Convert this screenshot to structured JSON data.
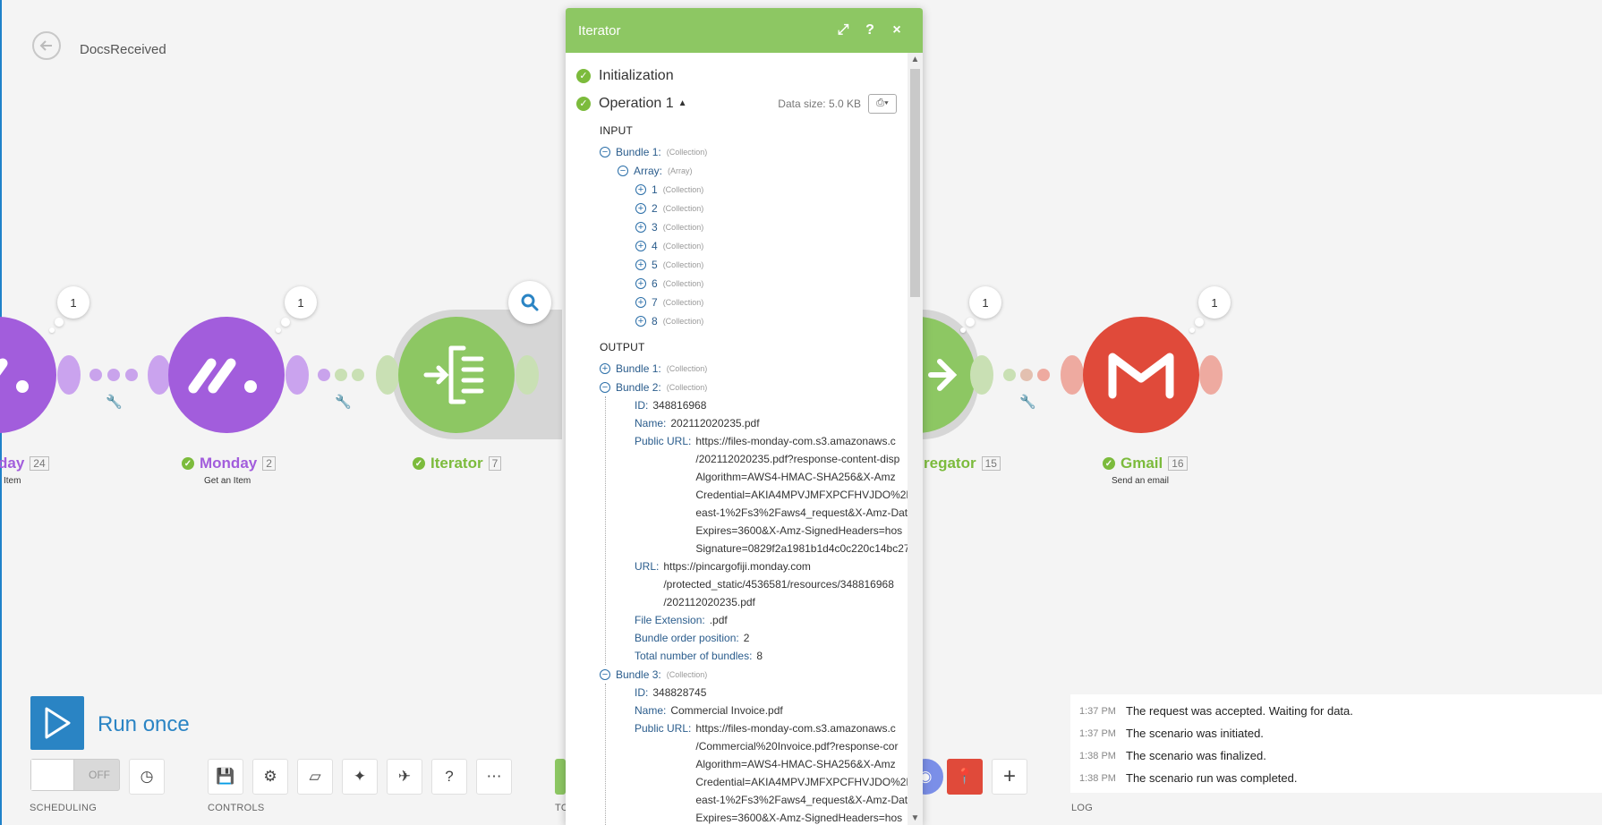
{
  "header": {
    "scenario_name": "DocsReceived"
  },
  "modules": [
    {
      "id": "m1",
      "label": "day",
      "number": "24",
      "subtitle": "Item",
      "badge": "1"
    },
    {
      "id": "m2",
      "label": "Monday",
      "number": "2",
      "subtitle": "Get an Item",
      "badge": "1"
    },
    {
      "id": "m3",
      "label": "Iterator",
      "number": "7",
      "subtitle": "",
      "badge": ""
    },
    {
      "id": "m4",
      "label": "regator",
      "number": "15",
      "subtitle": "",
      "badge": "1"
    },
    {
      "id": "m5",
      "label": "Gmail",
      "number": "16",
      "subtitle": "Send an email",
      "badge": "1"
    }
  ],
  "panel": {
    "title": "Iterator",
    "initialization": "Initialization",
    "operation": "Operation 1",
    "data_size": "Data size: 5.0 KB",
    "input_label": "INPUT",
    "output_label": "OUTPUT",
    "input": {
      "bundle": "Bundle 1:",
      "bundle_type": "(Collection)",
      "array": "Array:",
      "array_type": "(Array)",
      "items": [
        "1",
        "2",
        "3",
        "4",
        "5",
        "6",
        "7",
        "8"
      ],
      "item_type": "(Collection)"
    },
    "output": {
      "bundle1": "Bundle 1:",
      "bundle2": "Bundle 2:",
      "bundle3": "Bundle 3:",
      "type": "(Collection)",
      "b2": {
        "id_key": "ID:",
        "id": "348816968",
        "name_key": "Name:",
        "name": "202112020235.pdf",
        "public_url_key": "Public URL:",
        "public_url": [
          "https://files-monday-com.s3.amazonaws.c",
          "/202112020235.pdf?response-content-disp",
          "Algorithm=AWS4-HMAC-SHA256&X-Amz",
          "Credential=AKIA4MPVJMFXPCFHVJDO%2F",
          "east-1%2Fs3%2Faws4_request&X-Amz-Dat",
          "Expires=3600&X-Amz-SignedHeaders=hos",
          "Signature=0829f2a1981b1d4c0c220c14bc27"
        ],
        "url_key": "URL:",
        "url": [
          "https://pincargofiji.monday.com",
          "/protected_static/4536581/resources/348816968",
          "/202112020235.pdf"
        ],
        "ext_key": "File Extension:",
        "ext": ".pdf",
        "pos_key": "Bundle order position:",
        "pos": "2",
        "total_key": "Total number of bundles:",
        "total": "8"
      },
      "b3": {
        "id_key": "ID:",
        "id": "348828745",
        "name_key": "Name:",
        "name": "Commercial Invoice.pdf",
        "public_url_key": "Public URL:",
        "public_url": [
          "https://files-monday-com.s3.amazonaws.c",
          "/Commercial%20Invoice.pdf?response-cor",
          "Algorithm=AWS4-HMAC-SHA256&X-Amz",
          "Credential=AKIA4MPVJMFXPCFHVJDO%2F",
          "east-1%2Fs3%2Faws4_request&X-Amz-Dat",
          "Expires=3600&X-Amz-SignedHeaders=hos"
        ]
      }
    }
  },
  "toolbar": {
    "run_label": "Run once",
    "toggle_label": "OFF",
    "scheduling": "SCHEDULING",
    "controls": "CONTROLS",
    "tools": "TO",
    "log": "LOG"
  },
  "log": [
    {
      "time": "1:37 PM",
      "text": "The request was accepted. Waiting for data."
    },
    {
      "time": "1:37 PM",
      "text": "The scenario was initiated."
    },
    {
      "time": "1:38 PM",
      "text": "The scenario was finalized."
    },
    {
      "time": "1:38 PM",
      "text": "The scenario run was completed."
    }
  ],
  "colors": {
    "monday": "#a25ddc",
    "iterator": "#8dc763",
    "gmail": "#e04a3a",
    "accent": "#2a84c4"
  }
}
